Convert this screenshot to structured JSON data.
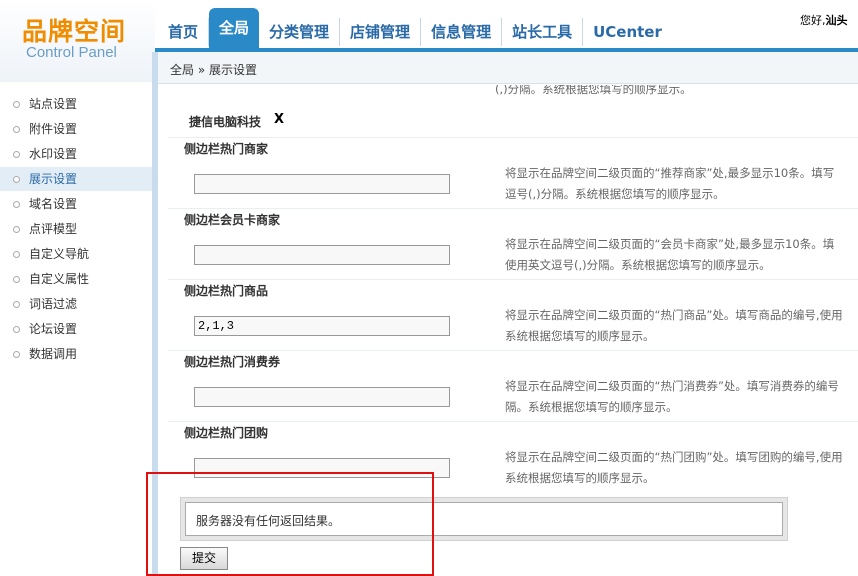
{
  "logo": {
    "title_cn": "品牌空间",
    "subtitle": "Control Panel"
  },
  "nav": {
    "items": [
      {
        "label": "首页"
      },
      {
        "label": "全局",
        "active": true
      },
      {
        "label": "分类管理"
      },
      {
        "label": "店铺管理"
      },
      {
        "label": "信息管理"
      },
      {
        "label": "站长工具"
      },
      {
        "label": "UCenter"
      }
    ]
  },
  "user": {
    "greeting": "您好,",
    "name": "汕头"
  },
  "breadcrumb": "全局 » 展示设置",
  "sidebar": {
    "items": [
      {
        "label": "站点设置"
      },
      {
        "label": "附件设置"
      },
      {
        "label": "水印设置"
      },
      {
        "label": "展示设置",
        "active": true
      },
      {
        "label": "域名设置"
      },
      {
        "label": "点评模型"
      },
      {
        "label": "自定义导航"
      },
      {
        "label": "自定义属性"
      },
      {
        "label": "词语过滤"
      },
      {
        "label": "论坛设置"
      },
      {
        "label": "数据调用"
      }
    ]
  },
  "main": {
    "top_help_fragment": "(,)分隔。系统根据您填写的顺序显示。",
    "tag": {
      "label": "捷信电脑科技",
      "remove": "X"
    },
    "fields": [
      {
        "label": "侧边栏热门商家",
        "value": "",
        "help1": "将显示在品牌空间二级页面的“推荐商家”处,最多显示10条。填写",
        "help2": "逗号(,)分隔。系统根据您填写的顺序显示。"
      },
      {
        "label": "侧边栏会员卡商家",
        "value": "",
        "help1": "将显示在品牌空间二级页面的“会员卡商家”处,最多显示10条。填",
        "help2": "使用英文逗号(,)分隔。系统根据您填写的顺序显示。"
      },
      {
        "label": "侧边栏热门商品",
        "value": "2,1,3",
        "help1": "将显示在品牌空间二级页面的“热门商品”处。填写商品的编号,使用",
        "help2": "系统根据您填写的顺序显示。"
      },
      {
        "label": "侧边栏热门消费券",
        "value": "",
        "help1": "将显示在品牌空间二级页面的“热门消费券”处。填写消费券的编号",
        "help2": "隔。系统根据您填写的顺序显示。"
      },
      {
        "label": "侧边栏热门团购",
        "value": "",
        "help1": "将显示在品牌空间二级页面的“热门团购”处。填写团购的编号,使用",
        "help2": "系统根据您填写的顺序显示。"
      }
    ],
    "result_message": "服务器没有任何返回结果。",
    "submit_label": "提交"
  },
  "colors": {
    "nav_active": "#2a8ac8",
    "logo_orange": "#f08c00",
    "highlight": "#e01010"
  }
}
